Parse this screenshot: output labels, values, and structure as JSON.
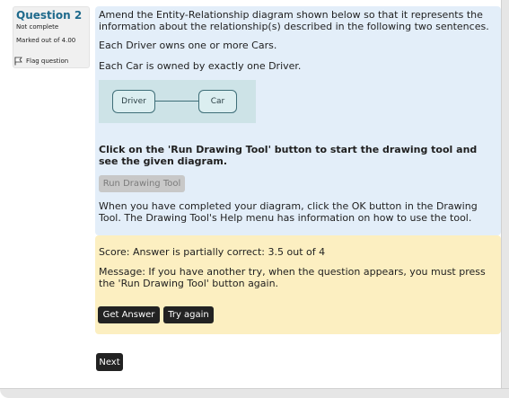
{
  "info": {
    "title": "Question 2",
    "state": "Not complete",
    "mark": "Marked out of 4.00",
    "flag_label": "Flag question"
  },
  "question": {
    "prompt": "Amend the Entity-Relationship diagram shown below so that it represents the information about the relationship(s) described in the following two sentences.",
    "sentence1": "Each Driver owns one or more Cars.",
    "sentence2": "Each Car is owned by exactly one Driver.",
    "diagram": {
      "entity1": "Driver",
      "entity2": "Car"
    },
    "instruction": "Click on the 'Run Drawing Tool' button to start the drawing tool and see the given diagram.",
    "run_button": "Run Drawing Tool",
    "after_text": "When you have completed your diagram, click the OK button in the Drawing Tool. The Drawing Tool's Help menu has information on how to use the tool."
  },
  "feedback": {
    "score": "Score: Answer is partially correct: 3.5 out of 4",
    "message": "Message: If you have another try, when the question appears, you must press the 'Run Drawing Tool' button again.",
    "get_answer": "Get Answer",
    "try_again": "Try again"
  },
  "nav": {
    "next": "Next"
  }
}
